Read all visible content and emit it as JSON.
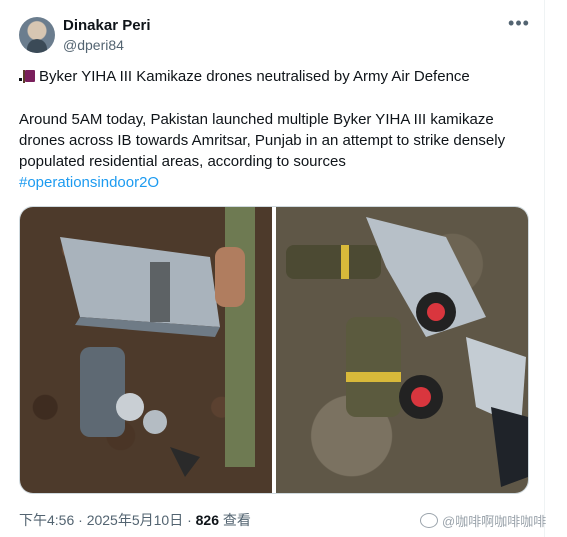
{
  "author": {
    "display_name": "Dinakar Peri",
    "handle": "@dperi84"
  },
  "more_label": "•••",
  "tweet": {
    "headline": "Byker YIHA III Kamikaze drones neutralised by Army Air Defence",
    "body": "Around 5AM today, Pakistan launched multiple Byker YIHA III kamikaze drones across IB towards Amritsar, Punjab in an attempt to strike densely populated residential areas, according to sources",
    "hashtag": "#operationsindoor2O"
  },
  "meta": {
    "time": "下午4:56 · 2025年5月10日 · ",
    "views_count": "826",
    "views_label": " 查看"
  },
  "watermark": "@咖啡啊咖啡咖啡",
  "icons": {
    "flag": "flag-icon",
    "avatar": "profile-avatar",
    "more": "more-horizontal-icon",
    "watermark_logo": "weibo-logo"
  }
}
